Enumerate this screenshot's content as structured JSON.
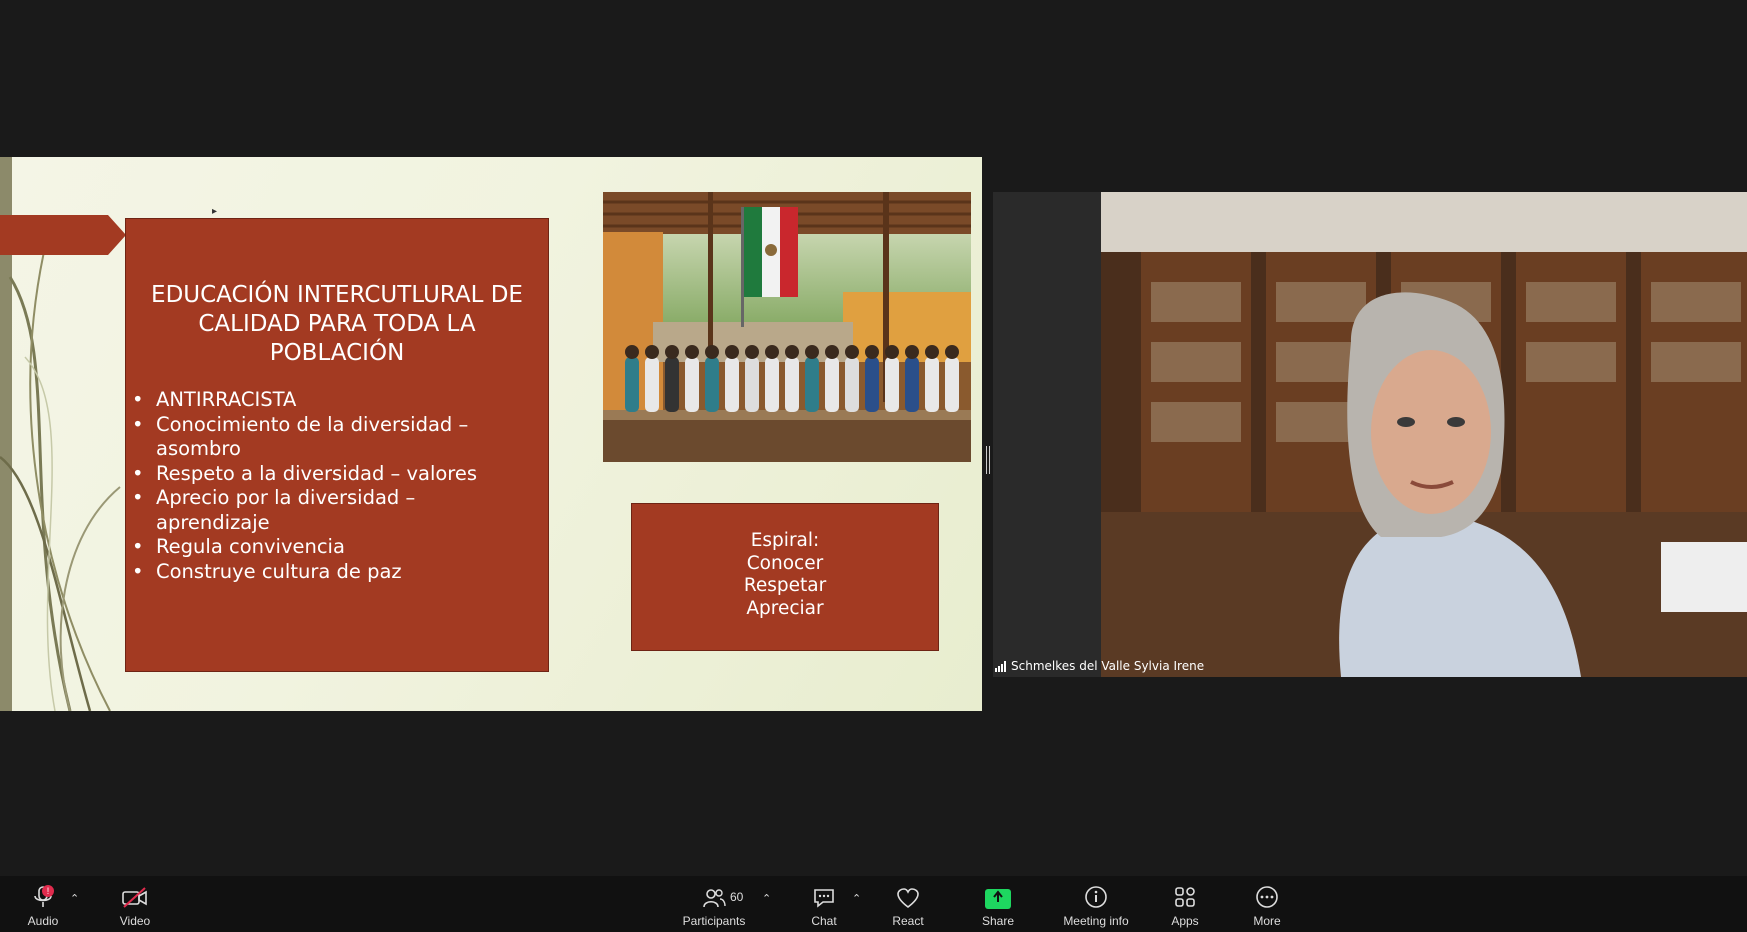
{
  "slide": {
    "title": "EDUCACIÓN INTERCUTLURAL DE CALIDAD PARA TODA LA POBLACIÓN",
    "bullets": [
      {
        "text": "ANTIRRACISTA"
      },
      {
        "text": "Conocimiento de la diversidad – asombro"
      },
      {
        "text": "Respeto a la diversidad – valores"
      },
      {
        "text": "Aprecio por la diversidad – aprendizaje"
      },
      {
        "text": "Regula convivencia"
      },
      {
        "text": "Construye cultura de paz"
      }
    ],
    "spiral": {
      "line1": "Espiral:",
      "line2": "Conocer",
      "line3": "Respetar",
      "line4": "Apreciar"
    },
    "accent_color": "#a33a22"
  },
  "participant": {
    "name": "Schmelkes del Valle Sylvia Irene"
  },
  "toolbar": {
    "audio": "Audio",
    "audio_badge": "!",
    "video": "Video",
    "participants": "Participants",
    "participants_count": "60",
    "chat": "Chat",
    "react": "React",
    "share": "Share",
    "meeting_info": "Meeting info",
    "apps": "Apps",
    "more": "More",
    "share_color": "#1ed760",
    "muted_color": "#e02b4d"
  }
}
